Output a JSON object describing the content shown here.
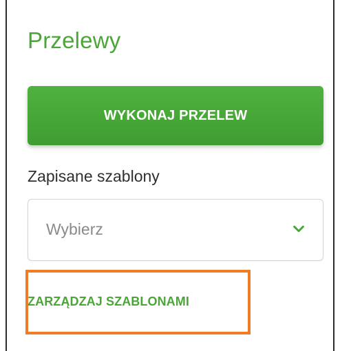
{
  "panel": {
    "title": "Przelewy",
    "primary_button_label": "WYKONAJ PRZELEW",
    "templates": {
      "label": "Zapisane szablony",
      "selected_value": "Wybierz"
    },
    "manage_link_label": "ZARZĄDZAJ SZABLONAMI"
  },
  "colors": {
    "accent_green": "#4aa637",
    "highlight_orange": "#f07d26"
  },
  "icons": {
    "dropdown": "chevron-down-icon"
  }
}
